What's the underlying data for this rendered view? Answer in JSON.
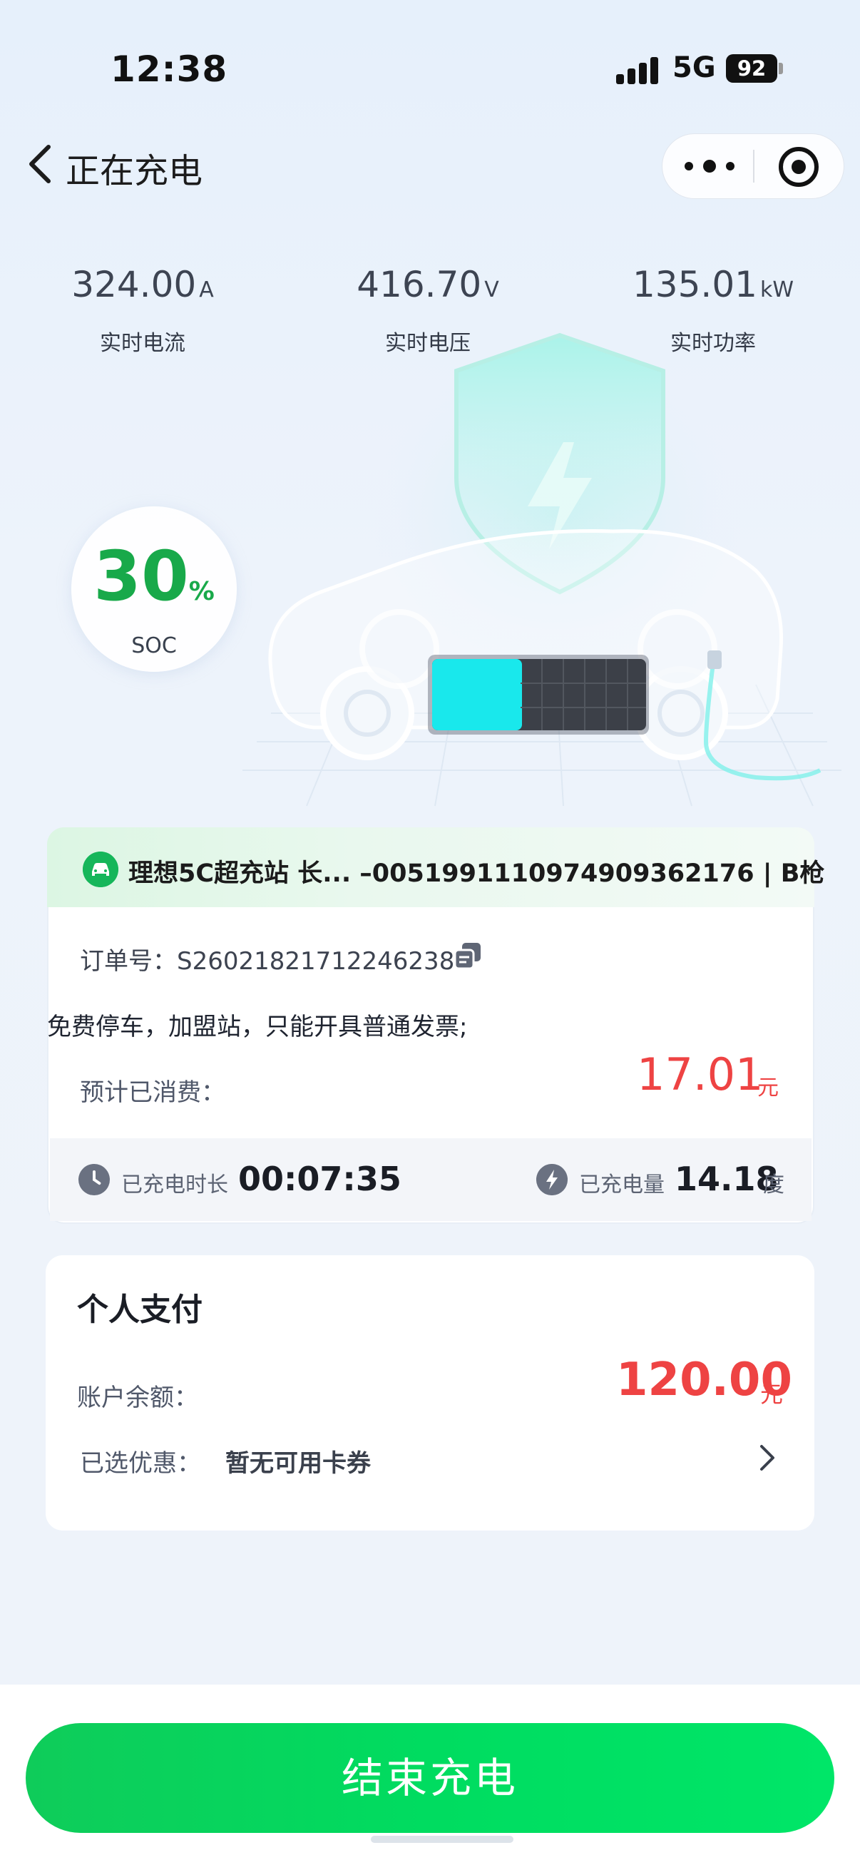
{
  "status_bar": {
    "time": "12:38",
    "network": "5G",
    "battery": "92"
  },
  "nav": {
    "title": "正在充电"
  },
  "metrics": [
    {
      "value": "324.00",
      "unit": "A",
      "label": "实时电流"
    },
    {
      "value": "416.70",
      "unit": "V",
      "label": "实时电压"
    },
    {
      "value": "135.01",
      "unit": "kW",
      "label": "实时功率"
    }
  ],
  "soc": {
    "value": "30",
    "unit": "%",
    "label": "SOC",
    "level": 0.3
  },
  "station_card": {
    "station": "理想5C超充站 长...  –005199111097490936217​6 | B枪",
    "order_label": "订单号：",
    "order_no": "S26021821712246238",
    "notice": "免费停车，加盟站，只能开具普通发票;",
    "spent_label": "预计已消费：",
    "spent_value": "17.01",
    "spent_unit": "元",
    "duration_label": "已充电时长",
    "duration_value": "00:07:35",
    "energy_label": "已充电量",
    "energy_value": "14.18",
    "energy_unit": "度"
  },
  "payment": {
    "title": "个人支付",
    "balance_label": "账户余额：",
    "balance_value": "120.00",
    "balance_unit": "元",
    "discount_label": "已选优惠：",
    "discount_value": "暂无可用卡券"
  },
  "action": {
    "end_label": "结束充电"
  },
  "colors": {
    "accent_green": "#00dc60",
    "price_red": "#ee4343",
    "soc_green": "#18a94a"
  }
}
